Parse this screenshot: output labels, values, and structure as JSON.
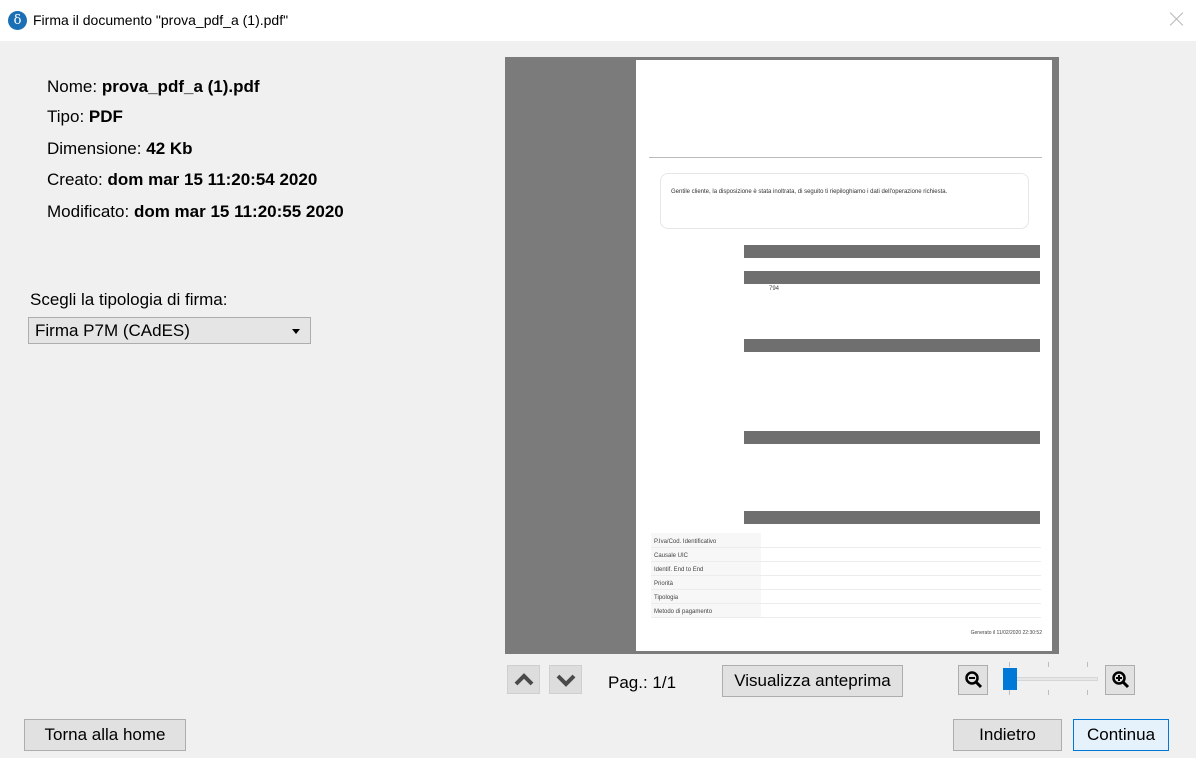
{
  "window": {
    "icon_glyph": "δ",
    "title": "Firma il documento \"prova_pdf_a (1).pdf\"",
    "close_icon": "close-icon"
  },
  "file_info": {
    "name_label": "Nome:",
    "name_value": "prova_pdf_a (1).pdf",
    "type_label": "Tipo:",
    "type_value": "PDF",
    "size_label": "Dimensione:",
    "size_value": "42 Kb",
    "created_label": "Creato:",
    "created_value": "dom mar 15 11:20:54 2020",
    "modified_label": "Modificato:",
    "modified_value": "dom mar 15 11:20:55 2020"
  },
  "signature": {
    "label": "Scegli la tipologia di firma:",
    "selected": "Firma P7M (CAdES)"
  },
  "preview_doc": {
    "notice": "Gentile cliente, la disposizione è stata inoltrata, di seguito ti riepiloghiamo i dati dell'operazione richiesta.",
    "snippet_1": "794",
    "row_labels": [
      "P.Iva/Cod. Identificativo",
      "Causale UIC",
      "Identif. End to End",
      "Priorità",
      "Tipologia",
      "Metodo di pagamento"
    ],
    "footer": "Generato il 11/02/2020 22:30:52"
  },
  "navigation": {
    "page_label": "Pag.: 1/1",
    "preview_button": "Visualizza anteprima",
    "zoom_level": 0.05
  },
  "footer_buttons": {
    "home": "Torna alla home",
    "back": "Indietro",
    "continue": "Continua"
  },
  "colors": {
    "accent": "#0078d7",
    "preview_bg": "#7b7b7b"
  }
}
